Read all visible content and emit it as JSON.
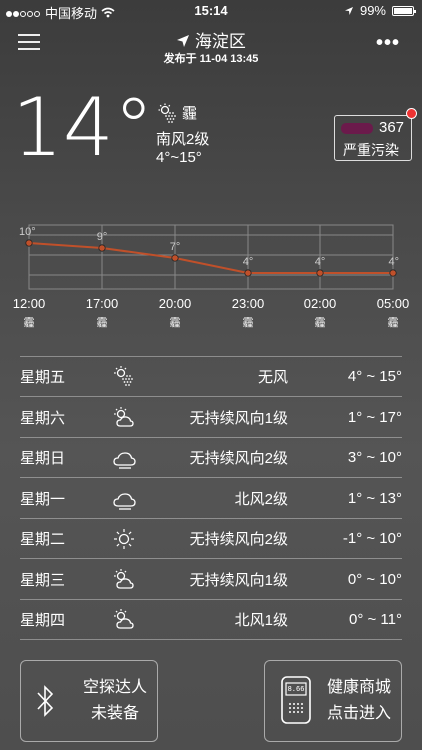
{
  "status": {
    "carrier": "中国移动",
    "time": "15:14",
    "battery": "99%",
    "battery_fraction": 0.99
  },
  "header": {
    "location": "海淀区",
    "published": "发布于 11-04 13:45"
  },
  "current": {
    "temp": "14°",
    "condition": "霾",
    "condition_icon": "haze-icon",
    "wind": "南风2级",
    "range": "4°~15°"
  },
  "aqi": {
    "value": "367",
    "level": "严重污染",
    "color": "#6b1a4b"
  },
  "hourly": [
    {
      "time": "12:00",
      "temp": "10°",
      "temp_value": 10,
      "cond": "霾"
    },
    {
      "time": "17:00",
      "temp": "9°",
      "temp_value": 9,
      "cond": "霾"
    },
    {
      "time": "20:00",
      "temp": "7°",
      "temp_value": 7,
      "cond": "霾"
    },
    {
      "time": "23:00",
      "temp": "4°",
      "temp_value": 4,
      "cond": "霾"
    },
    {
      "time": "02:00",
      "temp": "4°",
      "temp_value": 4,
      "cond": "霾"
    },
    {
      "time": "05:00",
      "temp": "4°",
      "temp_value": 4,
      "cond": "霾"
    }
  ],
  "daily": [
    {
      "day": "星期五",
      "icon": "haze-icon",
      "wind": "无风",
      "temp": "4° ~ 15°"
    },
    {
      "day": "星期六",
      "icon": "partly-cloudy-icon",
      "wind": "无持续风向1级",
      "temp": "1° ~ 17°"
    },
    {
      "day": "星期日",
      "icon": "cloudy-icon",
      "wind": "无持续风向2级",
      "temp": "3° ~ 10°"
    },
    {
      "day": "星期一",
      "icon": "cloudy-icon",
      "wind": "北风2级",
      "temp": "1° ~ 13°"
    },
    {
      "day": "星期二",
      "icon": "sunny-icon",
      "wind": "无持续风向2级",
      "temp": "-1° ~ 10°"
    },
    {
      "day": "星期三",
      "icon": "partly-cloudy-icon",
      "wind": "无持续风向1级",
      "temp": "0° ~ 10°"
    },
    {
      "day": "星期四",
      "icon": "partly-cloudy-icon",
      "wind": "北风1级",
      "temp": "0° ~ 11°"
    }
  ],
  "cards": {
    "left": {
      "line1": "空探达人",
      "line2": "未装备",
      "icon": "bluetooth-icon"
    },
    "right": {
      "line1": "健康商城",
      "line2": "点击进入",
      "icon": "air-monitor-icon",
      "device_reading": "8.66"
    }
  },
  "colors": {
    "chart_line": "#c0502a",
    "chart_point": "#c0502a",
    "grid": "#888888"
  }
}
